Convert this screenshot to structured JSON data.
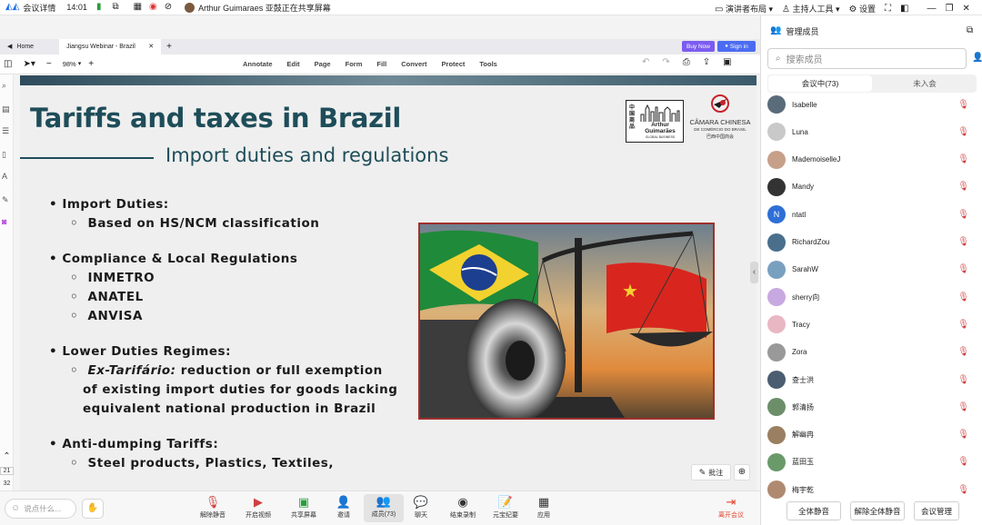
{
  "topbar": {
    "meeting_details": "会议详情",
    "time": "14:01",
    "sharing_notice": "Arthur Guimaraes 亚鼓正在共享屏幕",
    "presenter_layout": "演讲者布局",
    "host_tools": "主持人工具",
    "settings": "设置"
  },
  "browser": {
    "home_tab": "Home",
    "doc_tab": "Jiangsu Webinar - Brazil",
    "buy_now": "Buy Now",
    "sign_in": "Sign in"
  },
  "toolbar": {
    "zoom": "98%",
    "menus": [
      "Annotate",
      "Edit",
      "Page",
      "Form",
      "Fill",
      "Convert",
      "Protect",
      "Tools"
    ]
  },
  "slide": {
    "title": "Tariffs and taxes in Brazil",
    "subtitle": "Import duties and regulations",
    "bullets": [
      {
        "text": "Import Duties:",
        "subs": [
          "Based on HS/NCM classification"
        ]
      },
      {
        "text": "Compliance & Local Regulations",
        "subs": [
          "INMETRO",
          "ANATEL",
          "ANVISA"
        ]
      },
      {
        "text": "Lower Duties Regimes:",
        "subs": []
      },
      {
        "text": "Anti-dumping Tariffs:",
        "subs": [
          "Steel products, Plastics, Textiles,"
        ]
      }
    ],
    "ex_tarifario_term": "Ex-Tarifário:",
    "ex_tarifario_line1": " reduction or full exemption",
    "ex_tarifario_line2": "of existing import duties for goods lacking",
    "ex_tarifario_line3": "equivalent national production in Brazil",
    "logo1_name": "Arthur Guimarães",
    "logo1_sub": "GLOBAL BUSINESS",
    "logo1_cn": "中国商品",
    "logo2_name": "CÂMARA CHINESA",
    "logo2_sub": "DE COMÉRCIO DO BRASIL",
    "logo2_cn": "巴西中国商会"
  },
  "viewer": {
    "annotate_btn": "批注",
    "page_current": "21",
    "page_total": "32"
  },
  "bottombar": {
    "chat_placeholder": "说点什么...",
    "buttons": [
      "解除静音",
      "开启视频",
      "共享屏幕",
      "邀请",
      "成员(73)",
      "聊天",
      "结束录制",
      "元宝纪要",
      "应用"
    ],
    "leave": "离开会议"
  },
  "panel": {
    "title": "管理成员",
    "search_placeholder": "搜索成员",
    "tab_in_meeting": "会议中(73)",
    "tab_not_joined": "未入会",
    "members": [
      "Isabelle",
      "Luna",
      "MademoiselleJ",
      "Mandy",
      "ntatl",
      "RichardZou",
      "SarahW",
      "sherry向",
      "Tracy",
      "Zora",
      "查士洪",
      "郭清扬",
      "解幽冉",
      "蓝田玉",
      "梅宇乾"
    ],
    "avatar_letter_ntatl": "N",
    "mute_all": "全体静音",
    "unmute_all": "解除全体静音",
    "more": "会议管理"
  },
  "colors": {
    "accent": "#1e4d59",
    "mic_muted": "#d04040",
    "leave": "#e0452e",
    "buy_now": "#7b5cf0",
    "sign_in": "#4b6cf2"
  }
}
